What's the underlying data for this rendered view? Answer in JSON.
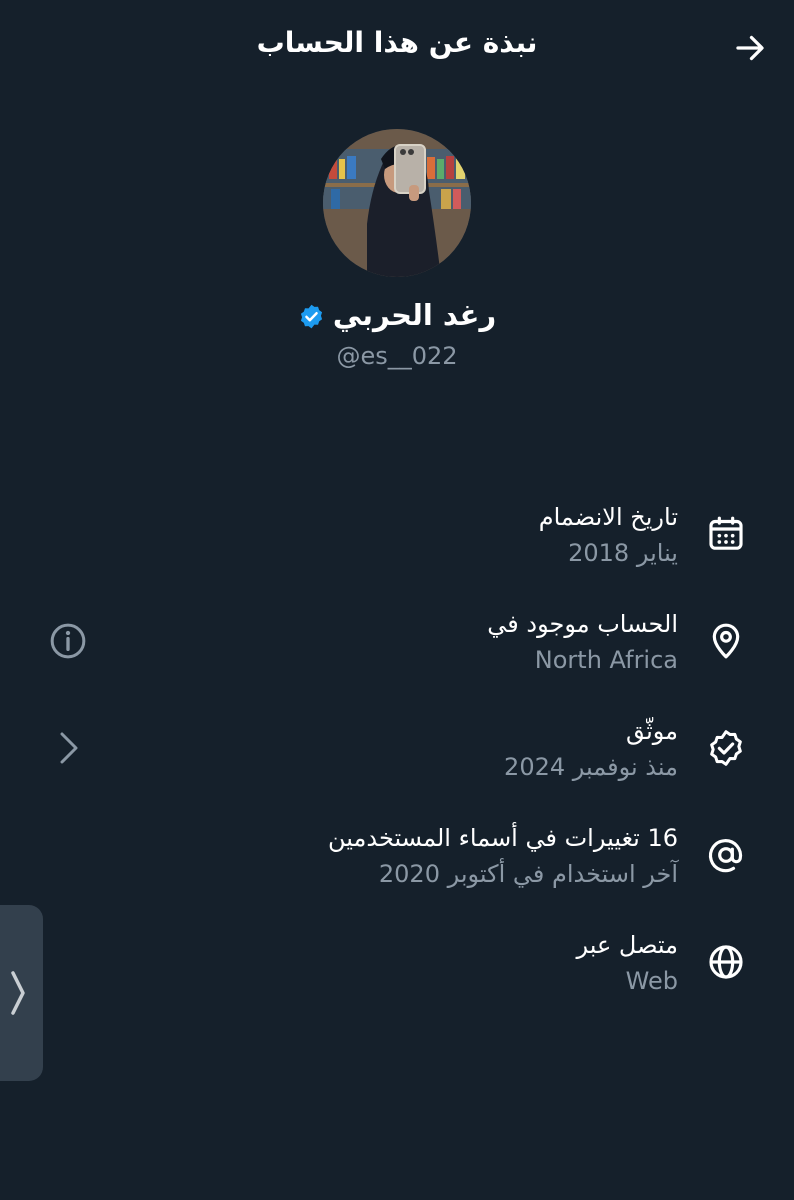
{
  "header": {
    "title": "نبذة عن هذا الحساب",
    "back_icon": "arrow-right-icon"
  },
  "profile": {
    "name": "رغد الحربي",
    "handle": "@es__022",
    "verified": true,
    "verified_color": "#1d9bf0",
    "avatar_icon": "profile-photo"
  },
  "details": [
    {
      "icon": "calendar-icon",
      "label": "تاريخ الانضمام",
      "value": "يناير 2018"
    },
    {
      "icon": "location-pin-icon",
      "label": "الحساب موجود في",
      "value": "North Africa"
    },
    {
      "icon": "verified-badge-icon",
      "label": "موثّق",
      "value": "منذ نوفمبر 2024"
    },
    {
      "icon": "at-sign-icon",
      "label": "16 تغييرات في أسماء المستخدمين",
      "value": "آخر استخدام في أكتوبر 2020"
    },
    {
      "icon": "globe-icon",
      "label": "متصل عبر",
      "value": "Web"
    }
  ],
  "side": {
    "info_icon": "info-circle-icon",
    "chevron_icon": "chevron-right-icon",
    "edge_tab_icon": "chevron-right-icon"
  },
  "colors": {
    "background": "#15202b",
    "primary_text": "#ffffff",
    "secondary_text": "#8b98a5",
    "accent": "#1d9bf0"
  }
}
